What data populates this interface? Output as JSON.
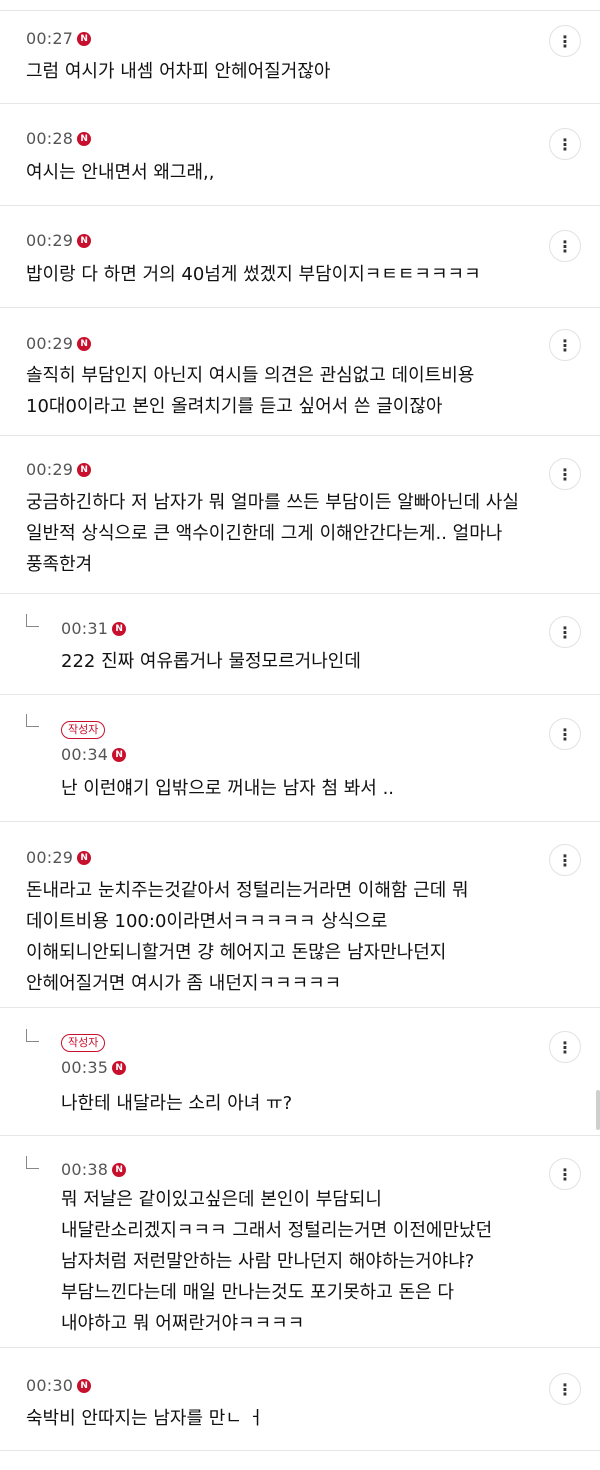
{
  "comments": [
    {
      "time": "00:27",
      "badge": "N",
      "text": "그럼 여시가 내셈 어차피 안헤어질거잖아",
      "more": "⋮"
    },
    {
      "time": "00:28",
      "badge": "N",
      "text": "여시는 안내면서 왜그래,,",
      "more": "⋮"
    },
    {
      "time": "00:29",
      "badge": "N",
      "text": "밥이랑 다 하면 거의 40넘게 썼겠지 부담이지ㅋㅌㅌㅋㅋㅋㅋ",
      "more": "⋮"
    },
    {
      "time": "00:29",
      "badge": "N",
      "text": "솔직히 부담인지 아닌지 여시들 의견은 관심없고 데이트비용\n10대0이라고 본인 올려치기를 듣고 싶어서 쓴 글이잖아",
      "more": "⋮"
    },
    {
      "time": "00:29",
      "badge": "N",
      "text": "궁금하긴하다 저 남자가 뭐 얼마를 쓰든 부담이든 알빠아닌데 사실\n일반적 상식으로 큰 액수이긴한데 그게 이해안간다는게.. 얼마나\n풍족한겨",
      "more": "⋮"
    },
    {
      "time": "00:31",
      "badge": "N",
      "text": "222 진짜 여유롭거나 물정모르거나인데",
      "more": "⋮",
      "reply": true
    },
    {
      "time": "00:34",
      "badge": "N",
      "text": "난 이런얘기 입밖으로 꺼내는 남자 첨 봐서 ..",
      "more": "⋮",
      "reply": true,
      "author": "작성자"
    },
    {
      "time": "00:29",
      "badge": "N",
      "text": "돈내라고 눈치주는것같아서 정털리는거라면 이해함 근데 뭐\n데이트비용 100:0이라면서ㅋㅋㅋㅋㅋ 상식으로\n이해되니안되니할거면 걍 헤어지고 돈많은 남자만나던지\n안헤어질거면 여시가 좀 내던지ㅋㅋㅋㅋㅋ",
      "more": "⋮"
    },
    {
      "time": "00:35",
      "badge": "N",
      "text": "나한테 내달라는 소리 아녀 ㅠ?",
      "more": "⋮",
      "reply": true,
      "author": "작성자"
    },
    {
      "time": "00:38",
      "badge": "N",
      "text": "뭐 저날은 같이있고싶은데 본인이 부담되니\n내달란소리겠지ㅋㅋㅋ 그래서 정털리는거면 이전에만났던\n남자처럼 저런말안하는 사람 만나던지 해야하는거야냐?\n부담느낀다는데 매일 만나는것도 포기못하고 돈은 다\n내야하고 뭐 어쩌란거야ㅋㅋㅋㅋ",
      "more": "⋮",
      "reply": true
    },
    {
      "time": "00:30",
      "badge": "N",
      "text": "숙박비 안따지는 남자를 만ㄴ ㅓ",
      "more": "⋮"
    }
  ]
}
